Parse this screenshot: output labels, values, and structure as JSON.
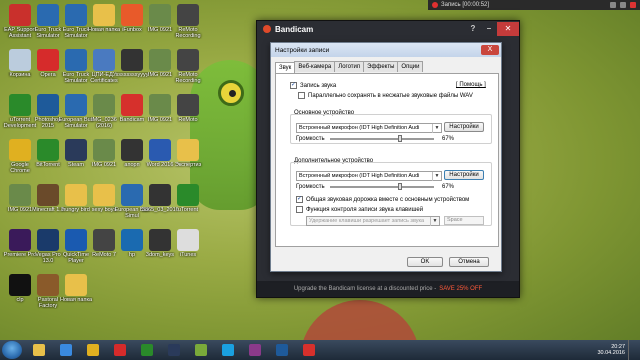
{
  "desktop": {
    "icons": [
      {
        "label": "ЕАР Support Assistant",
        "color": "#c9302c"
      },
      {
        "label": "Euro Truck Simulator",
        "color": "#2a6ab0"
      },
      {
        "label": "Euro Truck Simulator",
        "color": "#2a6ab0"
      },
      {
        "label": "Новая папка",
        "color": "#e8c04a"
      },
      {
        "label": "iFunbox",
        "color": "#e85a2a"
      },
      {
        "label": "IMG 0921",
        "color": "#6a8a4a"
      },
      {
        "label": "ReMoto Recording",
        "color": "#444"
      },
      {
        "label": "Корзина",
        "color": "#bcd"
      },
      {
        "label": "Opera",
        "color": "#d62b2b"
      },
      {
        "label": "Euro Truck Simulator",
        "color": "#2a6ab0"
      },
      {
        "label": "ЦПИ-ЕДУ Certificates",
        "color": "#4a7ac0"
      },
      {
        "label": "ssssssssyyyy",
        "color": "#333"
      },
      {
        "label": "IMG 0921",
        "color": "#6a8a4a"
      },
      {
        "label": "ReMoto Recording",
        "color": "#444"
      },
      {
        "label": "uTorrent Development",
        "color": "#2a8a2a"
      },
      {
        "label": "Photoshop 2015",
        "color": "#1e5a9a"
      },
      {
        "label": "European Bus Simulator",
        "color": "#2a6ab0"
      },
      {
        "label": "IMG_0236 (2016)",
        "color": "#6a8a4a"
      },
      {
        "label": "Bandicam",
        "color": "#d6302c"
      },
      {
        "label": "IMG 0921",
        "color": "#6a8a4a"
      },
      {
        "label": "ReMoto",
        "color": "#444"
      },
      {
        "label": "Google Chrome",
        "color": "#e0b020"
      },
      {
        "label": "BitTorrent",
        "color": "#2a8a2a"
      },
      {
        "label": "Steam",
        "color": "#2a3a5a"
      },
      {
        "label": "IMG 0921",
        "color": "#6a8a4a"
      },
      {
        "label": "апорп",
        "color": "#333"
      },
      {
        "label": "Word 2016",
        "color": "#2a5ab0"
      },
      {
        "label": "Экспертиз",
        "color": "#e8c04a"
      },
      {
        "label": "IMG 0921",
        "color": "#6a8a4a"
      },
      {
        "label": "Minecraft 1.8",
        "color": "#6a4a2a"
      },
      {
        "label": "hungry bird",
        "color": "#e8c04a"
      },
      {
        "label": "sexy boys",
        "color": "#e8c04a"
      },
      {
        "label": "European Bus Simul",
        "color": "#2a6ab0"
      },
      {
        "label": "3865_03_2016",
        "color": "#333"
      },
      {
        "label": "uTorrent",
        "color": "#2a8a2a"
      },
      {
        "label": "Premiere Pro",
        "color": "#3a1a5a"
      },
      {
        "label": "Vegas Pro 13.0",
        "color": "#1a3a6a"
      },
      {
        "label": "QuickTime Player",
        "color": "#1a5ab0"
      },
      {
        "label": "ReMoto 7",
        "color": "#444"
      },
      {
        "label": "hp",
        "color": "#1a6ab0"
      },
      {
        "label": "3dom_keys",
        "color": "#333"
      },
      {
        "label": "iTunes",
        "color": "#ddd"
      },
      {
        "label": "clp",
        "color": "#111"
      },
      {
        "label": "Pastoral Factory",
        "color": "#8a5a2a"
      },
      {
        "label": "Новая папка",
        "color": "#e8c04a"
      }
    ]
  },
  "record_bar": {
    "label": "Запись [00:00:52]"
  },
  "bandicam": {
    "title": "Bandicam",
    "footer_text": "Upgrade the Bandicam license at a discounted price -",
    "footer_sale": "SAVE 25% OFF"
  },
  "dialog": {
    "title": "Настройки записи",
    "close": "X",
    "tabs": [
      "Звук",
      "Веб-камера",
      "Логотип",
      "Эффекты",
      "Опции"
    ],
    "record_sound": "Запись звука",
    "help": "[ Помощь ]",
    "save_wav": "Параллельно сохранять в несжатые звуковые файлы WAV",
    "main_device_label": "Основное устройство",
    "main_device_value": "Встроенный микрофон (IDT High Definition Audi",
    "settings_btn": "Настройки",
    "volume_label": "Громкость",
    "main_volume": "67%",
    "extra_device_label": "Дополнительное устройство",
    "extra_device_value": "Встроенный микрофон (IDT High Definition Audi",
    "extra_volume": "67%",
    "mix_track": "Общая звуковая дорожка вместе с основным устройством",
    "key_control": "Функция контроля записи звука клавишей",
    "hold_key_value": "Удержание клавиши разрешает запись звука",
    "key_value": "Space",
    "ok": "OK",
    "cancel": "Отмена"
  },
  "taskbar": {
    "apps": [
      {
        "name": "explorer",
        "color": "#e8c04a"
      },
      {
        "name": "media-player",
        "color": "#3a8ae0"
      },
      {
        "name": "chrome",
        "color": "#e0b020"
      },
      {
        "name": "opera",
        "color": "#d62b2b"
      },
      {
        "name": "utorrent",
        "color": "#2a8a2a"
      },
      {
        "name": "steam",
        "color": "#2a3a5a"
      },
      {
        "name": "bandicam-app",
        "color": "#7aaa3a"
      },
      {
        "name": "skype",
        "color": "#1aa0e0"
      },
      {
        "name": "winrar",
        "color": "#8a3a8a"
      },
      {
        "name": "photoshop",
        "color": "#1e5a9a"
      },
      {
        "name": "bandicam",
        "color": "#d6302c"
      }
    ],
    "time": "20:27",
    "date": "30.04.2016"
  }
}
